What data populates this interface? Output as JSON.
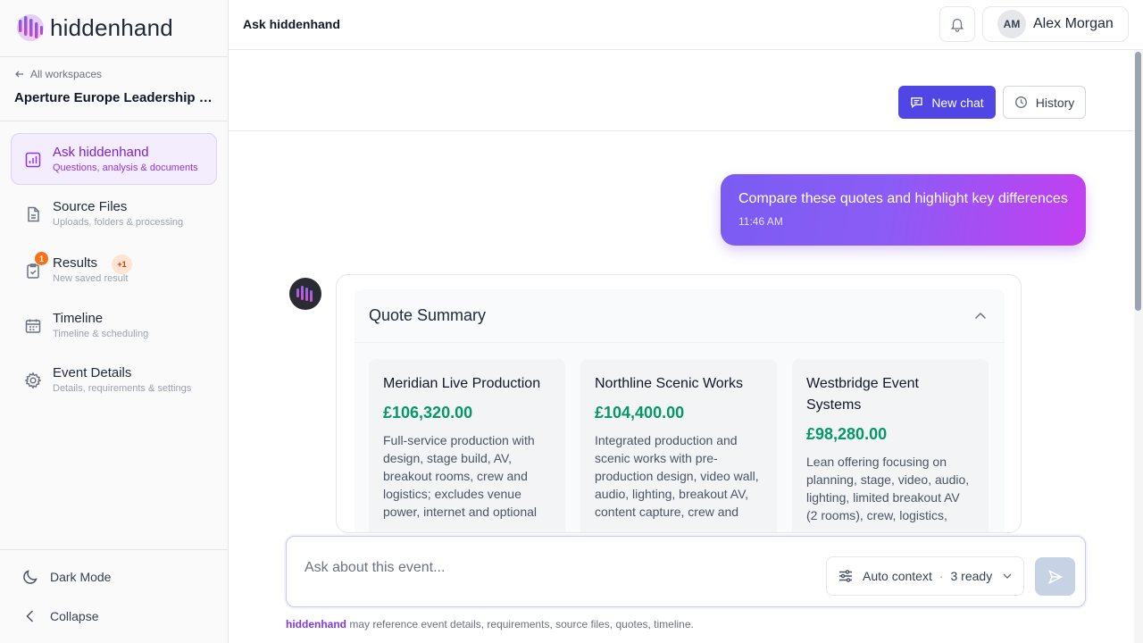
{
  "brand": {
    "name": "hiddenhand",
    "colors": {
      "accent": "#4f46e5",
      "purple": "#7c3aed",
      "success": "#059669",
      "badge": "#f97316"
    }
  },
  "sidebar": {
    "back_label": "All workspaces",
    "workspace_title": "Aperture Europe Leadership S...",
    "items": [
      {
        "label": "Ask hiddenhand",
        "sub": "Questions, analysis & documents",
        "icon": "bar-chart-icon",
        "active": true
      },
      {
        "label": "Source Files",
        "sub": "Uploads, folders & processing",
        "icon": "file-icon"
      },
      {
        "label": "Results",
        "sub": "New saved result",
        "icon": "clipboard-check-icon",
        "badge": "1",
        "pill": "+1"
      },
      {
        "label": "Timeline",
        "sub": "Timeline & scheduling",
        "icon": "calendar-icon"
      },
      {
        "label": "Event Details",
        "sub": "Details, requirements & settings",
        "icon": "gear-icon"
      }
    ],
    "dark_mode_label": "Dark Mode",
    "collapse_label": "Collapse"
  },
  "header": {
    "title": "Ask hiddenhand",
    "user": {
      "initials": "AM",
      "name": "Alex Morgan"
    }
  },
  "chat": {
    "new_chat_label": "New chat",
    "history_label": "History",
    "user_message": {
      "text": "Compare these quotes and highlight key differences",
      "time": "11:46 AM"
    },
    "summary": {
      "title": "Quote Summary",
      "quotes": [
        {
          "name": "Meridian Live Production",
          "price": "£106,320.00",
          "desc": "Full-service production with design, stage build, AV, breakout rooms, crew and logistics; excludes venue power, internet and optional"
        },
        {
          "name": "Northline Scenic Works",
          "price": "£104,400.00",
          "desc": "Integrated production and scenic works with pre-production design, video wall, audio, lighting, breakout AV, content capture, crew and"
        },
        {
          "name": "Westbridge Event Systems",
          "price": "£98,280.00",
          "desc": "Lean offering focusing on planning, stage, video, audio, lighting, limited breakout AV (2 rooms), crew, logistics,"
        }
      ]
    }
  },
  "composer": {
    "placeholder": "Ask about this event...",
    "context_label": "Auto context",
    "context_sep": "·",
    "context_count": "3 ready"
  },
  "footnote": {
    "brand": "hiddenhand",
    "text": " may reference event details, requirements, source files, quotes, timeline."
  }
}
